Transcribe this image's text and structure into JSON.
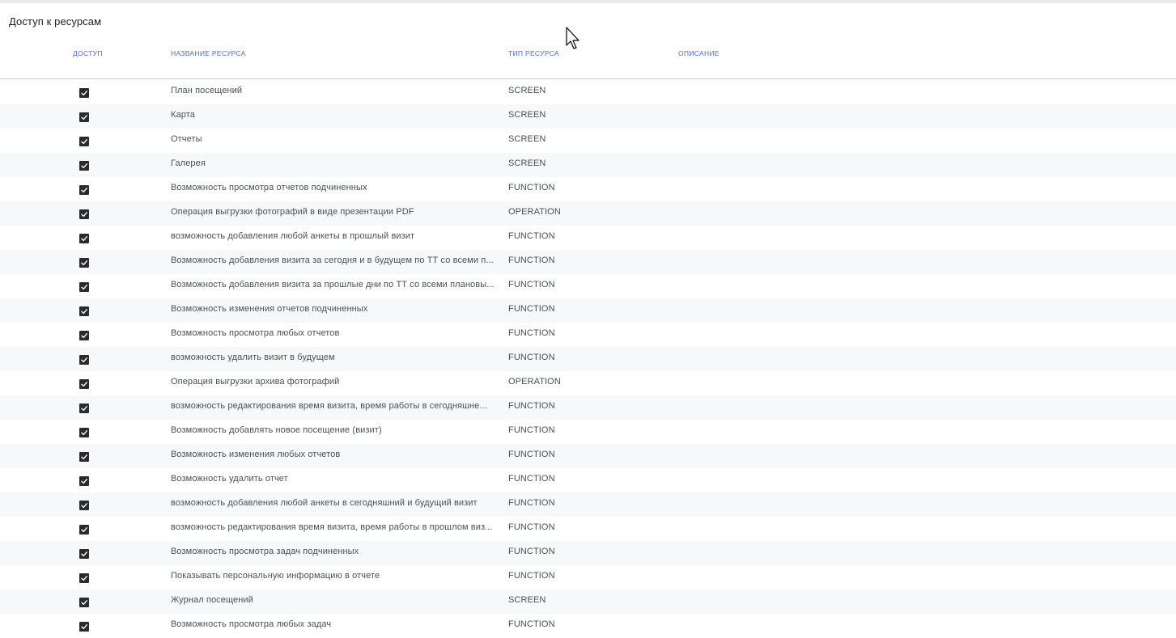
{
  "page": {
    "title": "Доступ к ресурсам"
  },
  "table": {
    "columns": {
      "access": "ДОСТУП",
      "name": "НАЗВАНИЕ РЕСУРСА",
      "type": "ТИП РЕСУРСА",
      "description": "ОПИСАНИЕ"
    },
    "rows": [
      {
        "checked": true,
        "name": "План посещений",
        "type": "SCREEN",
        "description": ""
      },
      {
        "checked": true,
        "name": "Карта",
        "type": "SCREEN",
        "description": ""
      },
      {
        "checked": true,
        "name": "Отчеты",
        "type": "SCREEN",
        "description": ""
      },
      {
        "checked": true,
        "name": "Галерея",
        "type": "SCREEN",
        "description": ""
      },
      {
        "checked": true,
        "name": "Возможность просмотра отчетов подчиненных",
        "type": "FUNCTION",
        "description": ""
      },
      {
        "checked": true,
        "name": "Операция выгрузки фотографий в виде презентации PDF",
        "type": "OPERATION",
        "description": ""
      },
      {
        "checked": true,
        "name": "возможность добавления любой анкеты в прошлый визит",
        "type": "FUNCTION",
        "description": ""
      },
      {
        "checked": true,
        "name": "Возможность добавления визита за сегодня и в будущем по ТТ со всеми п...",
        "type": "FUNCTION",
        "description": ""
      },
      {
        "checked": true,
        "name": "Возможность добавления визита за прошлые дни по ТТ со всеми плановы...",
        "type": "FUNCTION",
        "description": ""
      },
      {
        "checked": true,
        "name": "Возможность изменения отчетов подчиненных",
        "type": "FUNCTION",
        "description": ""
      },
      {
        "checked": true,
        "name": "Возможность просмотра любых отчетов",
        "type": "FUNCTION",
        "description": ""
      },
      {
        "checked": true,
        "name": "возможность удалить визит в будущем",
        "type": "FUNCTION",
        "description": ""
      },
      {
        "checked": true,
        "name": "Операция выгрузки архива фотографий",
        "type": "OPERATION",
        "description": ""
      },
      {
        "checked": true,
        "name": "возможность редактирования время визита, время работы в сегодняшне...",
        "type": "FUNCTION",
        "description": ""
      },
      {
        "checked": true,
        "name": "Возможность добавлять новое посещение (визит)",
        "type": "FUNCTION",
        "description": ""
      },
      {
        "checked": true,
        "name": "Возможность изменения любых отчетов",
        "type": "FUNCTION",
        "description": ""
      },
      {
        "checked": true,
        "name": "Возможность удалить отчет",
        "type": "FUNCTION",
        "description": ""
      },
      {
        "checked": true,
        "name": "возможность добавления любой анкеты в сегодняшний и будущий визит",
        "type": "FUNCTION",
        "description": ""
      },
      {
        "checked": true,
        "name": "возможность редактирования время визита, время работы в прошлом виз...",
        "type": "FUNCTION",
        "description": ""
      },
      {
        "checked": true,
        "name": "Возможность просмотра задач подчиненных",
        "type": "FUNCTION",
        "description": ""
      },
      {
        "checked": true,
        "name": "Показывать персональную информацию в отчете",
        "type": "FUNCTION",
        "description": ""
      },
      {
        "checked": true,
        "name": "Журнал посещений",
        "type": "SCREEN",
        "description": ""
      },
      {
        "checked": true,
        "name": "Возможность просмотра любых задач",
        "type": "FUNCTION",
        "description": ""
      }
    ]
  },
  "colors": {
    "header_text": "#4a6fd8",
    "checkbox": "#2b2b2b",
    "row_alt": "#f7f8fa"
  },
  "icons": {
    "cursor": "mouse-pointer-icon",
    "checkbox": "checkbox-checked-icon"
  }
}
